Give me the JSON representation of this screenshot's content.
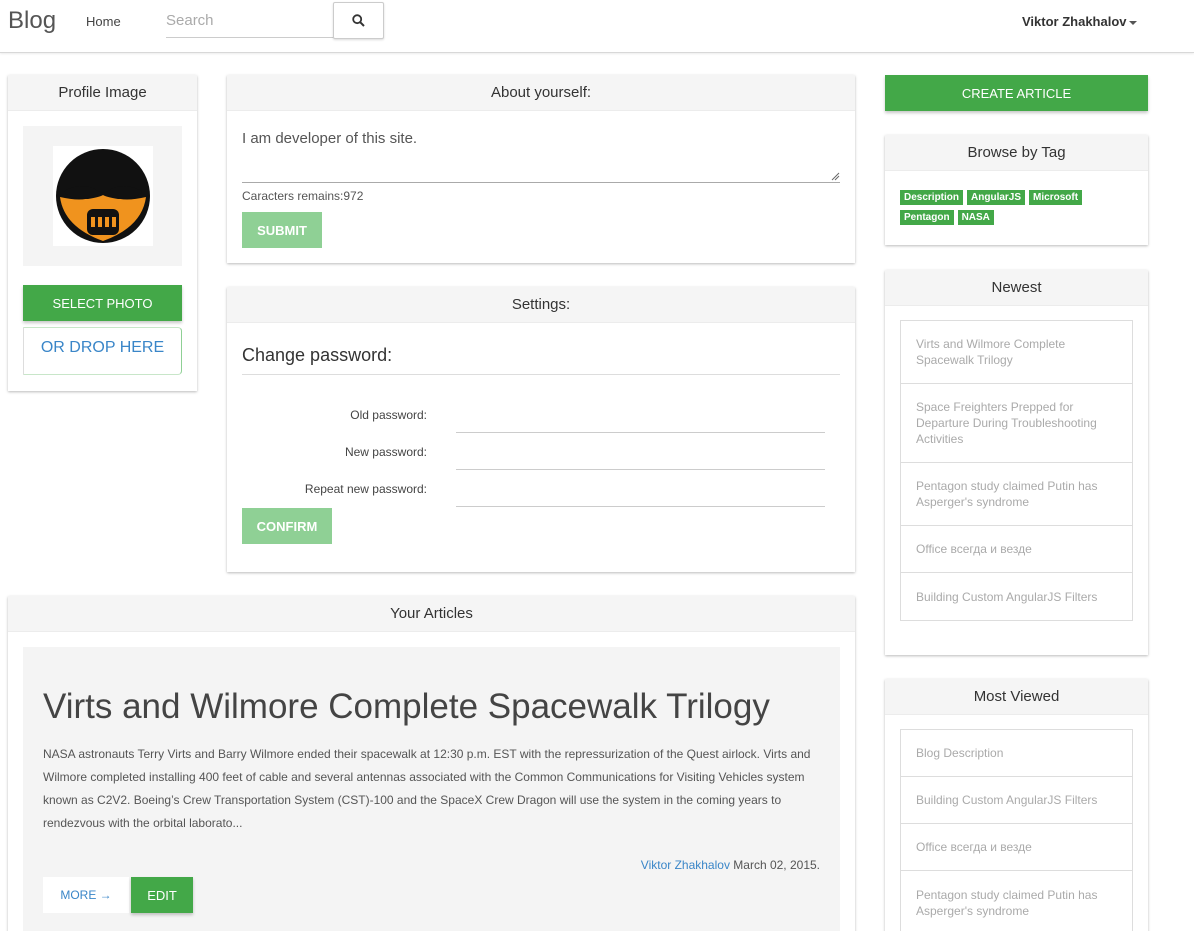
{
  "navbar": {
    "brand": "Blog",
    "home": "Home",
    "search_placeholder": "Search",
    "user_name": "Viktor Zhakhalov"
  },
  "profile": {
    "title": "Profile Image",
    "select_photo": "SELECT PHOTO",
    "drop_here": "OR DROP HERE"
  },
  "about": {
    "title": "About yourself:",
    "text": "I am developer of this site.",
    "chars_remaining": "Caracters remains:972",
    "submit": "SUBMIT"
  },
  "settings": {
    "title": "Settings:",
    "change_password": "Change password:",
    "old_password": "Old password:",
    "new_password": "New password:",
    "repeat_password": "Repeat new password:",
    "confirm": "CONFIRM"
  },
  "articles": {
    "title": "Your Articles",
    "items": [
      {
        "title": "Virts and Wilmore Complete Spacewalk Trilogy",
        "body": "NASA astronauts Terry Virts and Barry Wilmore ended their spacewalk at 12:30 p.m. EST with the repressurization of the Quest airlock. Virts and Wilmore completed installing 400 feet of cable and several antennas associated with the Common Communications for Visiting Vehicles system known as C2V2. Boeing’s Crew Transportation System (CST)-100 and the SpaceX Crew Dragon will use the system in the coming years to rendezvous with the orbital laborato...",
        "author": "Viktor Zhakhalov",
        "date": "March 02, 2015.",
        "more": "MORE →",
        "edit": "EDIT"
      }
    ]
  },
  "sidebar": {
    "create_article": "CREATE ARTICLE",
    "tags_title": "Browse by Tag",
    "tags": [
      "Description",
      "AngularJS",
      "Microsoft",
      "Pentagon",
      "NASA"
    ],
    "newest_title": "Newest",
    "newest": [
      "Virts and Wilmore Complete Spacewalk Trilogy",
      "Space Freighters Prepped for Departure During Troubleshooting Activities",
      "Pentagon study claimed Putin has Asperger's syndrome",
      "Office всегда и везде",
      "Building Custom AngularJS Filters"
    ],
    "most_viewed_title": "Most Viewed",
    "most_viewed": [
      "Blog Description",
      "Building Custom AngularJS Filters",
      "Office всегда и везде",
      "Pentagon study claimed Putin has Asperger's syndrome"
    ]
  },
  "colors": {
    "accent_green": "#43a848",
    "faded_green": "#8fd095",
    "link_blue": "#3a86c8"
  }
}
